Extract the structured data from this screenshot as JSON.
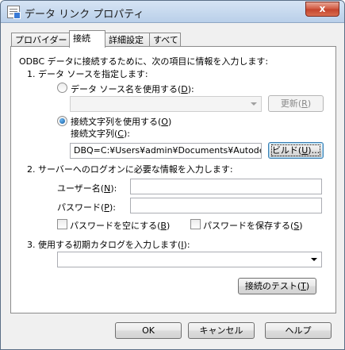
{
  "window": {
    "title": "データ リンク プロパティ",
    "close": "x"
  },
  "tabs": [
    {
      "label": "プロバイダー"
    },
    {
      "label": "接続"
    },
    {
      "label": "詳細設定"
    },
    {
      "label": "すべて"
    }
  ],
  "intro": "ODBC データに接続するために、次の項目に情報を入力します:",
  "step1": {
    "heading": "1. データ ソースを指定します:",
    "dsn_radio": {
      "label": "データ ソース名を使用する(",
      "key": "D",
      "suffix": "):"
    },
    "dsn_select": {
      "value": ""
    },
    "refresh_button": {
      "label": "更新(",
      "key": "R",
      "suffix": ")"
    },
    "connstr_radio": {
      "label": "接続文字列を使用する(",
      "key": "O",
      "suffix": ")"
    },
    "connstr_label": {
      "label": "接続文字列(",
      "key": "C",
      "suffix": "):"
    },
    "connstr_value": "DBQ=C:¥Users¥admin¥Documents¥Autodesk¥",
    "build_button": {
      "label": "ビルド(",
      "key": "U",
      "suffix": ")..."
    }
  },
  "step2": {
    "heading": "2. サーバーへのログオンに必要な情報を入力します:",
    "user": {
      "label": "ユーザー名(",
      "key": "N",
      "suffix": "):",
      "value": ""
    },
    "password": {
      "label": "パスワード(",
      "key": "P",
      "suffix": "):",
      "value": ""
    },
    "blank_password": {
      "label": "パスワードを空にする(",
      "key": "B",
      "suffix": ")"
    },
    "save_password": {
      "label": "パスワードを保存する(",
      "key": "S",
      "suffix": ")"
    }
  },
  "step3": {
    "heading": {
      "label": "3. 使用する初期カタログを入力します(",
      "key": "I",
      "suffix": "):"
    },
    "catalog": {
      "value": ""
    }
  },
  "test_button": {
    "label": "接続のテスト(",
    "key": "T",
    "suffix": ")"
  },
  "footer": {
    "ok": "OK",
    "cancel": "キャンセル",
    "help": "ヘルプ"
  }
}
